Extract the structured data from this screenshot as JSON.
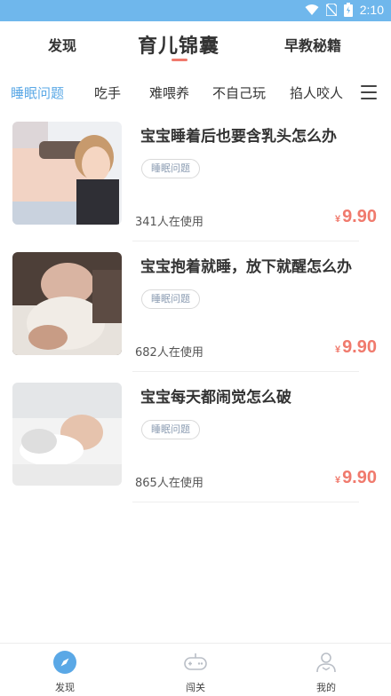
{
  "statusbar": {
    "time": "2:10"
  },
  "header": {
    "left": "发现",
    "title": "育儿锦囊",
    "right": "早教秘籍"
  },
  "categories": [
    "睡眠问题",
    "吃手",
    "难喂养",
    "不自己玩",
    "掐人咬人"
  ],
  "items": [
    {
      "title": "宝宝睡着后也要含乳头怎么办",
      "tag": "睡眠问题",
      "users": "341人在使用",
      "currency": "¥",
      "price": "9.90"
    },
    {
      "title": "宝宝抱着就睡，放下就醒怎么办",
      "tag": "睡眠问题",
      "users": "682人在使用",
      "currency": "¥",
      "price": "9.90"
    },
    {
      "title": "宝宝每天都闹觉怎么破",
      "tag": "睡眠问题",
      "users": "865人在使用",
      "currency": "¥",
      "price": "9.90"
    }
  ],
  "tabbar": [
    {
      "label": "发现",
      "icon": "compass-icon"
    },
    {
      "label": "闯关",
      "icon": "gamepad-icon"
    },
    {
      "label": "我的",
      "icon": "user-icon"
    }
  ],
  "colors": {
    "statusbar": "#6fb7ec",
    "accent": "#5aa8e6",
    "price": "#f07a6d"
  }
}
